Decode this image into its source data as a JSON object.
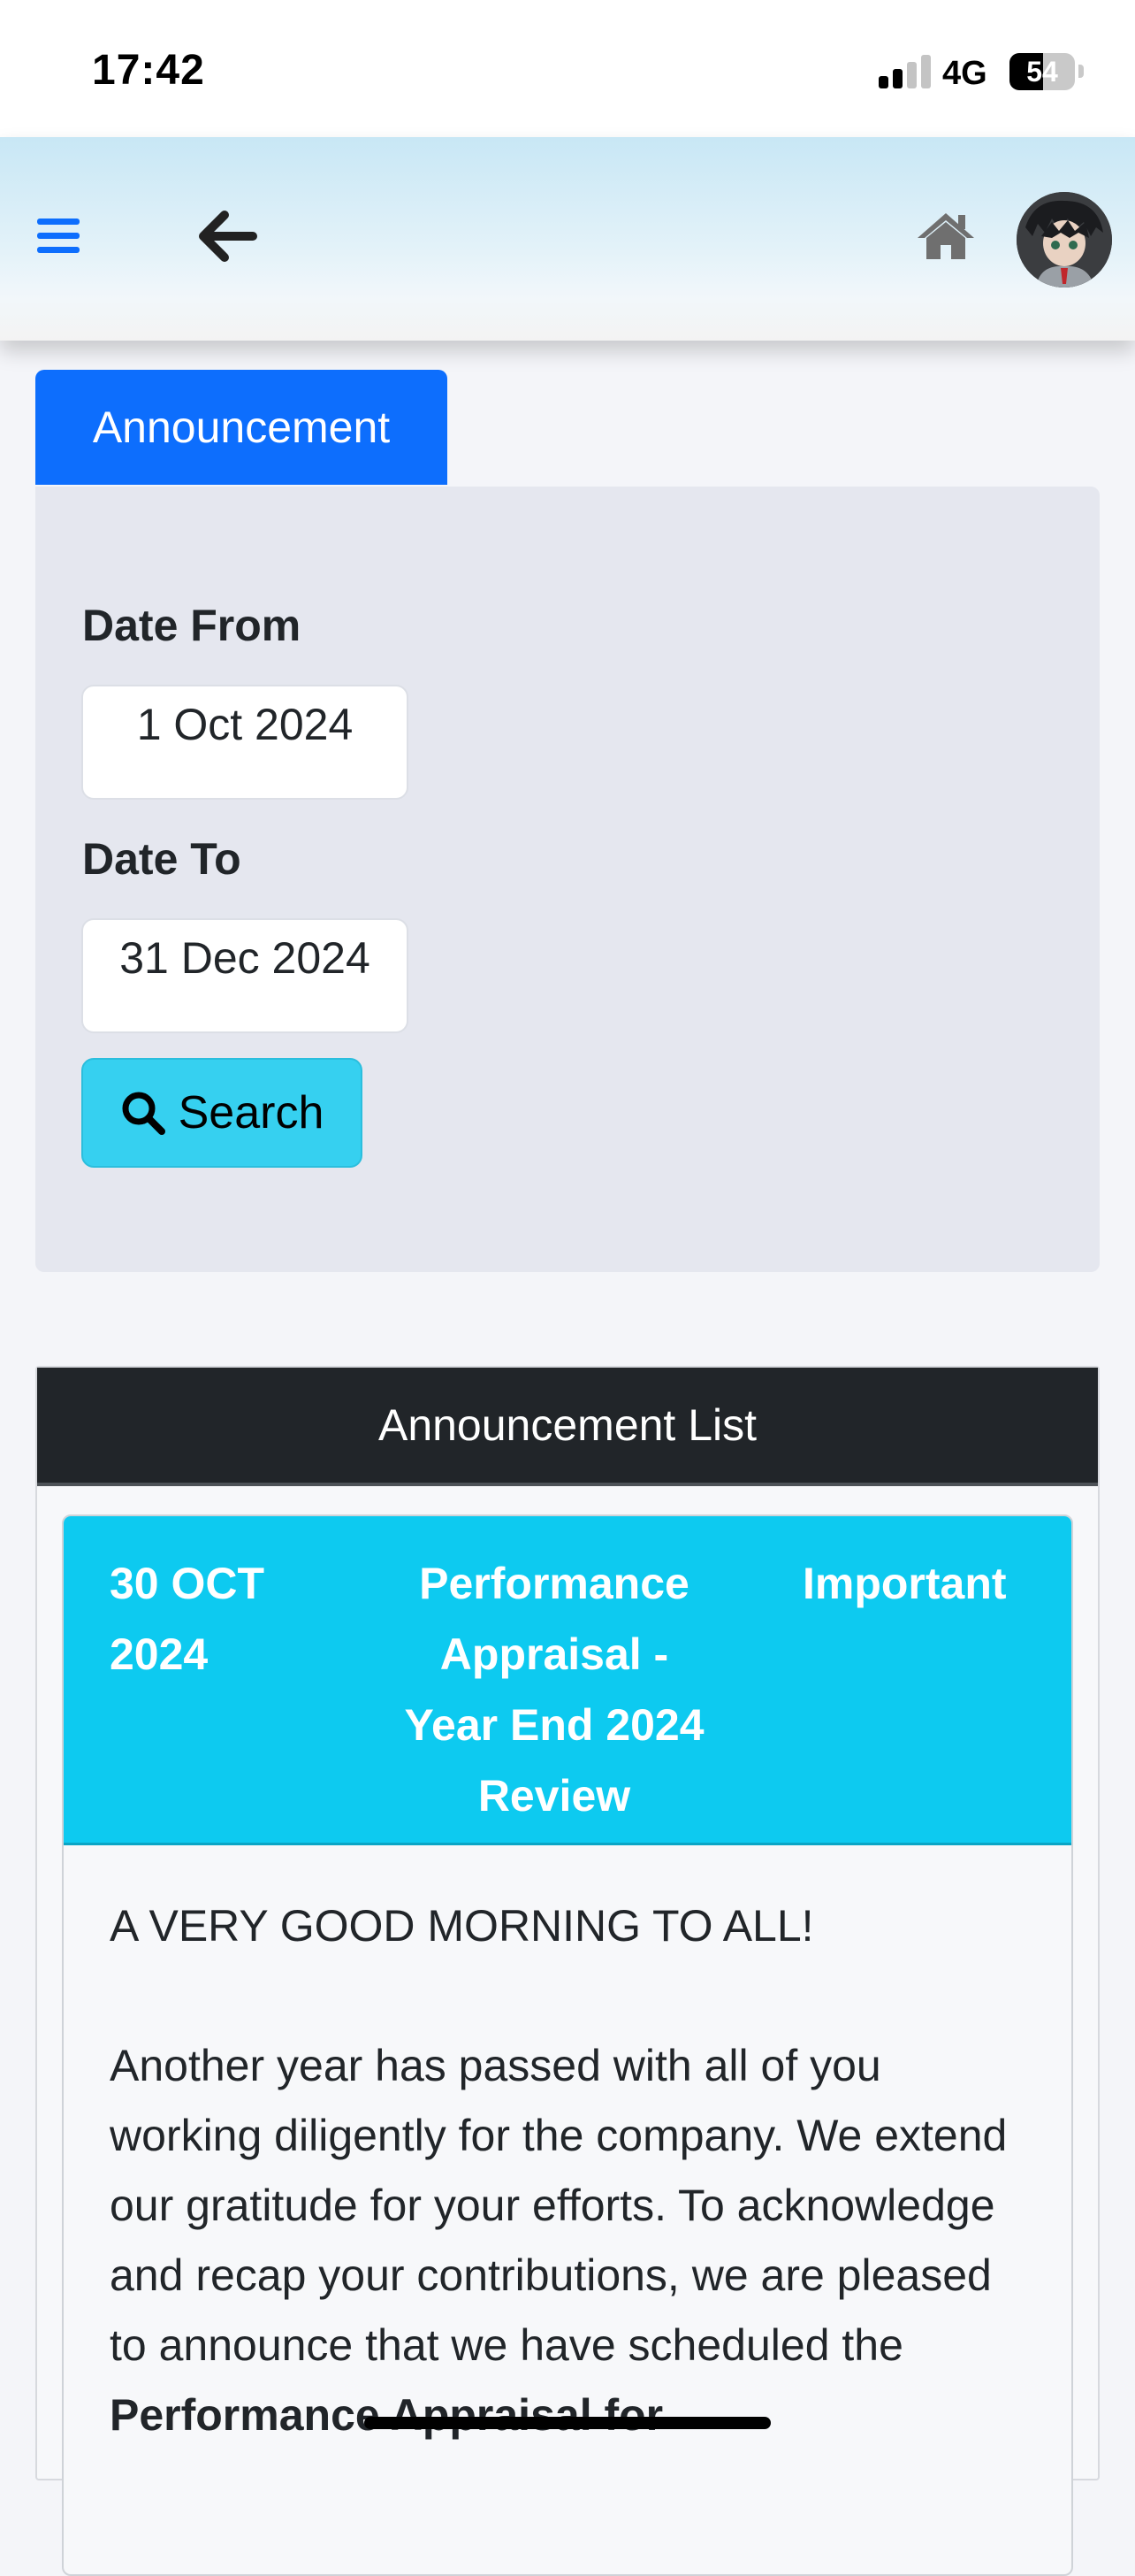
{
  "status_bar": {
    "time": "17:42",
    "network": "4G",
    "battery": "54"
  },
  "header": {
    "menu_icon": "hamburger-menu-icon",
    "back_icon": "arrow-left-icon",
    "home_icon": "home-icon",
    "colors": {
      "icon_blue": "#0d6efd",
      "gradient_top": "#c8e7f5"
    }
  },
  "tabs": {
    "announcement": "Announcement"
  },
  "filter": {
    "date_from_label": "Date From",
    "date_from_value": "1 Oct 2024",
    "date_to_label": "Date To",
    "date_to_value": "31 Dec 2024",
    "search_label": "Search",
    "search_icon": "magnifier-icon"
  },
  "list": {
    "header": "Announcement List",
    "items": [
      {
        "date": "30 OCT 2024",
        "title": "Performance Appraisal - Year End 2024 Review",
        "tag": "Important",
        "greeting": "A VERY GOOD MORNING TO ALL!",
        "body_text": "Another year has passed with all of you working diligently for the company. We extend our gratitude for your efforts. To acknowledge and recap your contributions, we are pleased to announce that we have scheduled the ",
        "body_bold": "Performance Appraisal for"
      }
    ]
  },
  "colors": {
    "primary": "#0d6efd",
    "info": "#0dcaf0",
    "dark": "#212529",
    "panel": "#e5e7ef"
  }
}
